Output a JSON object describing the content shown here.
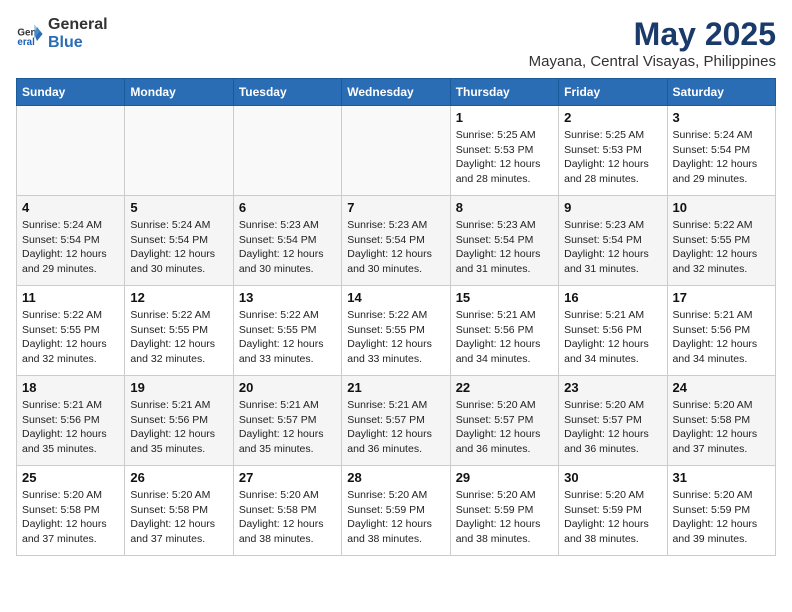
{
  "header": {
    "logo_general": "General",
    "logo_blue": "Blue",
    "title": "May 2025",
    "subtitle": "Mayana, Central Visayas, Philippines"
  },
  "days_of_week": [
    "Sunday",
    "Monday",
    "Tuesday",
    "Wednesday",
    "Thursday",
    "Friday",
    "Saturday"
  ],
  "weeks": [
    [
      {
        "day": "",
        "info": ""
      },
      {
        "day": "",
        "info": ""
      },
      {
        "day": "",
        "info": ""
      },
      {
        "day": "",
        "info": ""
      },
      {
        "day": "1",
        "info": "Sunrise: 5:25 AM\nSunset: 5:53 PM\nDaylight: 12 hours\nand 28 minutes."
      },
      {
        "day": "2",
        "info": "Sunrise: 5:25 AM\nSunset: 5:53 PM\nDaylight: 12 hours\nand 28 minutes."
      },
      {
        "day": "3",
        "info": "Sunrise: 5:24 AM\nSunset: 5:54 PM\nDaylight: 12 hours\nand 29 minutes."
      }
    ],
    [
      {
        "day": "4",
        "info": "Sunrise: 5:24 AM\nSunset: 5:54 PM\nDaylight: 12 hours\nand 29 minutes."
      },
      {
        "day": "5",
        "info": "Sunrise: 5:24 AM\nSunset: 5:54 PM\nDaylight: 12 hours\nand 30 minutes."
      },
      {
        "day": "6",
        "info": "Sunrise: 5:23 AM\nSunset: 5:54 PM\nDaylight: 12 hours\nand 30 minutes."
      },
      {
        "day": "7",
        "info": "Sunrise: 5:23 AM\nSunset: 5:54 PM\nDaylight: 12 hours\nand 30 minutes."
      },
      {
        "day": "8",
        "info": "Sunrise: 5:23 AM\nSunset: 5:54 PM\nDaylight: 12 hours\nand 31 minutes."
      },
      {
        "day": "9",
        "info": "Sunrise: 5:23 AM\nSunset: 5:54 PM\nDaylight: 12 hours\nand 31 minutes."
      },
      {
        "day": "10",
        "info": "Sunrise: 5:22 AM\nSunset: 5:55 PM\nDaylight: 12 hours\nand 32 minutes."
      }
    ],
    [
      {
        "day": "11",
        "info": "Sunrise: 5:22 AM\nSunset: 5:55 PM\nDaylight: 12 hours\nand 32 minutes."
      },
      {
        "day": "12",
        "info": "Sunrise: 5:22 AM\nSunset: 5:55 PM\nDaylight: 12 hours\nand 32 minutes."
      },
      {
        "day": "13",
        "info": "Sunrise: 5:22 AM\nSunset: 5:55 PM\nDaylight: 12 hours\nand 33 minutes."
      },
      {
        "day": "14",
        "info": "Sunrise: 5:22 AM\nSunset: 5:55 PM\nDaylight: 12 hours\nand 33 minutes."
      },
      {
        "day": "15",
        "info": "Sunrise: 5:21 AM\nSunset: 5:56 PM\nDaylight: 12 hours\nand 34 minutes."
      },
      {
        "day": "16",
        "info": "Sunrise: 5:21 AM\nSunset: 5:56 PM\nDaylight: 12 hours\nand 34 minutes."
      },
      {
        "day": "17",
        "info": "Sunrise: 5:21 AM\nSunset: 5:56 PM\nDaylight: 12 hours\nand 34 minutes."
      }
    ],
    [
      {
        "day": "18",
        "info": "Sunrise: 5:21 AM\nSunset: 5:56 PM\nDaylight: 12 hours\nand 35 minutes."
      },
      {
        "day": "19",
        "info": "Sunrise: 5:21 AM\nSunset: 5:56 PM\nDaylight: 12 hours\nand 35 minutes."
      },
      {
        "day": "20",
        "info": "Sunrise: 5:21 AM\nSunset: 5:57 PM\nDaylight: 12 hours\nand 35 minutes."
      },
      {
        "day": "21",
        "info": "Sunrise: 5:21 AM\nSunset: 5:57 PM\nDaylight: 12 hours\nand 36 minutes."
      },
      {
        "day": "22",
        "info": "Sunrise: 5:20 AM\nSunset: 5:57 PM\nDaylight: 12 hours\nand 36 minutes."
      },
      {
        "day": "23",
        "info": "Sunrise: 5:20 AM\nSunset: 5:57 PM\nDaylight: 12 hours\nand 36 minutes."
      },
      {
        "day": "24",
        "info": "Sunrise: 5:20 AM\nSunset: 5:58 PM\nDaylight: 12 hours\nand 37 minutes."
      }
    ],
    [
      {
        "day": "25",
        "info": "Sunrise: 5:20 AM\nSunset: 5:58 PM\nDaylight: 12 hours\nand 37 minutes."
      },
      {
        "day": "26",
        "info": "Sunrise: 5:20 AM\nSunset: 5:58 PM\nDaylight: 12 hours\nand 37 minutes."
      },
      {
        "day": "27",
        "info": "Sunrise: 5:20 AM\nSunset: 5:58 PM\nDaylight: 12 hours\nand 38 minutes."
      },
      {
        "day": "28",
        "info": "Sunrise: 5:20 AM\nSunset: 5:59 PM\nDaylight: 12 hours\nand 38 minutes."
      },
      {
        "day": "29",
        "info": "Sunrise: 5:20 AM\nSunset: 5:59 PM\nDaylight: 12 hours\nand 38 minutes."
      },
      {
        "day": "30",
        "info": "Sunrise: 5:20 AM\nSunset: 5:59 PM\nDaylight: 12 hours\nand 38 minutes."
      },
      {
        "day": "31",
        "info": "Sunrise: 5:20 AM\nSunset: 5:59 PM\nDaylight: 12 hours\nand 39 minutes."
      }
    ]
  ]
}
